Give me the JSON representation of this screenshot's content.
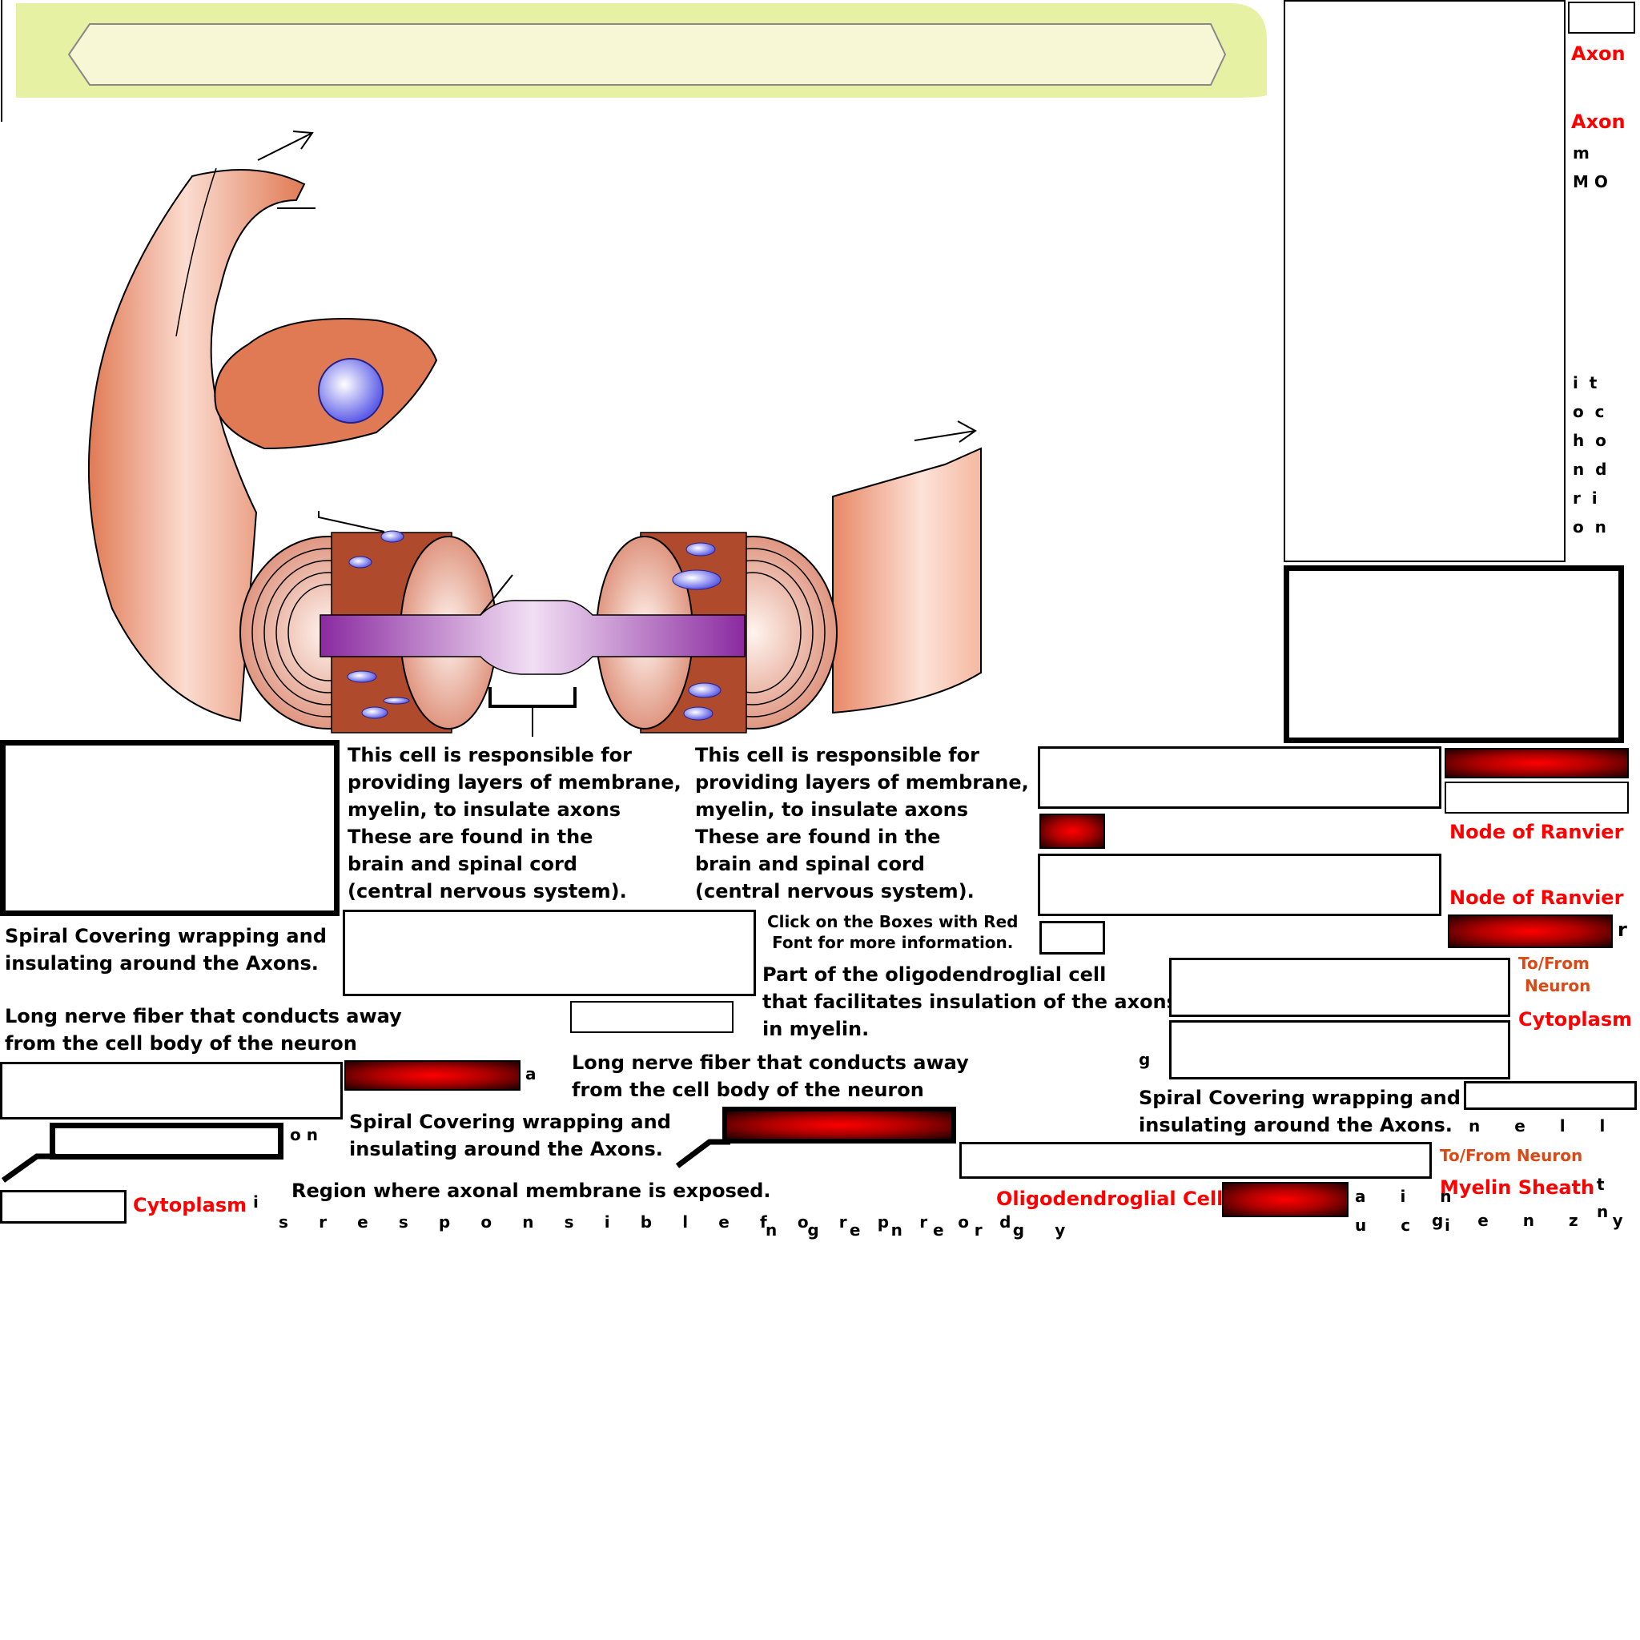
{
  "blocks": {
    "cell_desc_1": [
      "This cell is responsible for",
      "providing layers of membrane,",
      "myelin, to insulate axons",
      "These are  found in the",
      "brain and spinal cord",
      "(central nervous system)."
    ],
    "cell_desc_2": [
      "This cell is responsible for",
      "providing layers of membrane,",
      "myelin, to insulate axons",
      "These are  found in the",
      "brain and spinal cord",
      "(central nervous system)."
    ],
    "spiral_1": [
      "Spiral Covering wrapping and",
      "insulating around the Axons."
    ],
    "spiral_2": [
      "Spiral Covering wrapping and",
      "insulating around the Axons."
    ],
    "spiral_3": [
      "Spiral Covering wrapping and",
      "insulating around the Axons."
    ],
    "long_nerve_1": [
      "Long nerve fiber that conducts away",
      "from the cell body of the neuron"
    ],
    "long_nerve_2": [
      "Long nerve fiber that conducts away",
      "from the cell body of the neuron"
    ],
    "click_info": [
      "Click on the Boxes with Red",
      "Font for more information."
    ],
    "part_of_oligo": [
      "Part of the oligodendroglial cell",
      "that facilitates insulation of the axons",
      "in myelin."
    ],
    "region_exposed": "Region where axonal membrane is exposed."
  },
  "labels": {
    "axon_1": "Axon",
    "axon_2": "Axon",
    "node_of_ranvier_1": "Node of Ranvier",
    "node_of_ranvier_2": "Node of Ranvier",
    "to_from_neuron_1a": "To/From",
    "to_from_neuron_1b": "Neuron",
    "cytoplasm_1": "Cytoplasm",
    "cytoplasm_2": "Cytoplasm",
    "to_from_neuron_2": "To/From Neuron",
    "myelin_sheath": "Myelin Sheath",
    "oligodendroglial_cell": "Oligodendroglial Cell"
  },
  "fragments": {
    "m": "m",
    "mo": "M O",
    "vertical_mito": "i  t\no  c\nh  o\nn  d\nr  i\no  n",
    "a": "a",
    "on": "o n",
    "i": "i",
    "g": "g",
    "r": "r",
    "t": "t",
    "n": "n",
    "nellec": "n e l l e c",
    "ain": "a i n",
    "uci": "u c i",
    "genzye": "g e n z y e",
    "responsible": "s r e s p o n s i b l e f o r p r o d",
    "energy": "n g e n e r g y"
  },
  "colors": {
    "cell_body": "#e07a55",
    "myelin_dark": "#a0452a",
    "axon": "#9b2fa8",
    "nucleus": "#7b7bf0",
    "banner": "#eef4b8",
    "label_red": "#ff0000",
    "label_orange": "#d84a18"
  }
}
